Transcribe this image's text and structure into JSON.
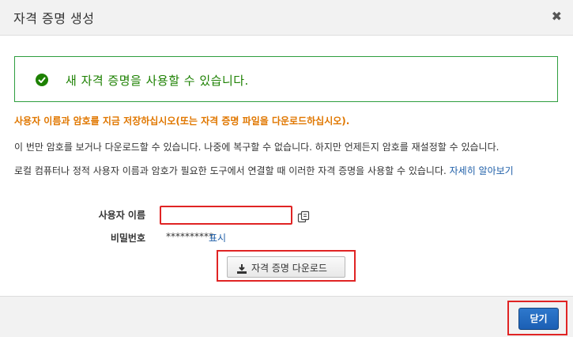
{
  "dialog": {
    "title": "자격 증명 생성",
    "close_glyph": "✖"
  },
  "alert": {
    "message": "새 자격 증명을 사용할 수 있습니다.",
    "icon": "check-circle-icon",
    "color": "#1d8102"
  },
  "warning": {
    "text": "사용자 이름과 암호를 지금 저장하십시오(또는 자격 증명 파일을 다운로드하십시오).",
    "color": "#e07700"
  },
  "info": {
    "line1": "이 번만 암호를 보거나 다운로드할 수 있습니다. 나중에 복구할 수 없습니다. 하지만 언제든지 암호를 재설정할 수 있습니다.",
    "line2": "로컬 컴퓨터나 정적 사용자 이름과 암호가 필요한 도구에서 연결할 때 이러한 자격 증명을 사용할 수 있습니다. ",
    "learn_more": "자세히 알아보기"
  },
  "credentials": {
    "username_label": "사용자 이름",
    "username_value": "",
    "password_label": "비밀번호",
    "password_mask": "**********",
    "show_label": "표시",
    "copy_icon": "copy-icon"
  },
  "download": {
    "label": "자격 증명 다운로드",
    "icon": "download-icon"
  },
  "footer": {
    "close_label": "닫기",
    "accent": "#1b5fb4"
  },
  "highlight_color": "#e02424"
}
